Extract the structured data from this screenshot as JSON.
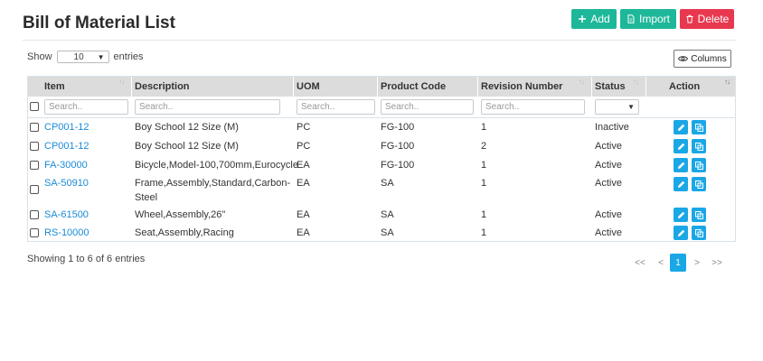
{
  "page": {
    "title": "Bill of Material List"
  },
  "toolbar": {
    "add_label": "Add",
    "import_label": "Import",
    "delete_label": "Delete"
  },
  "length": {
    "show_label": "Show",
    "value": "10",
    "entries_label": "entries"
  },
  "columns_button": {
    "label": "Columns"
  },
  "table": {
    "headers": {
      "item": "Item",
      "description": "Description",
      "uom": "UOM",
      "product_code": "Product Code",
      "revision": "Revision Number",
      "status": "Status",
      "action": "Action"
    },
    "filters": {
      "item": "Search..",
      "description": "Search..",
      "uom": "Search..",
      "product_code": "Search..",
      "revision": "Search.."
    },
    "rows": [
      {
        "item": "CP001-12",
        "description": "Boy School 12 Size (M)",
        "description_2": "",
        "uom": "PC",
        "product_code": "FG-100",
        "revision": "1",
        "status": "Inactive"
      },
      {
        "item": "CP001-12",
        "description": "Boy School 12 Size (M)",
        "description_2": "",
        "uom": "PC",
        "product_code": "FG-100",
        "revision": "2",
        "status": "Active"
      },
      {
        "item": "FA-30000",
        "description": "Bicycle,Model-100,700mm,Eurocycle",
        "description_2": "",
        "uom": "EA",
        "product_code": "FG-100",
        "revision": "1",
        "status": "Active"
      },
      {
        "item": "SA-50910",
        "description": "Frame,Assembly,Standard,Carbon-",
        "description_2": "Steel",
        "uom": "EA",
        "product_code": "SA",
        "revision": "1",
        "status": "Active"
      },
      {
        "item": "SA-61500",
        "description": "Wheel,Assembly,26\"",
        "description_2": "",
        "uom": "EA",
        "product_code": "SA",
        "revision": "1",
        "status": "Active"
      },
      {
        "item": "RS-10000",
        "description": "Seat,Assembly,Racing",
        "description_2": "",
        "uom": "EA",
        "product_code": "SA",
        "revision": "1",
        "status": "Active"
      }
    ]
  },
  "footer": {
    "info": "Showing 1 to 6 of 6 entries"
  },
  "pagination": {
    "first": "<<",
    "prev": "<",
    "current": "1",
    "next": ">",
    "last": ">>"
  },
  "colors": {
    "accent": "#1fb79a",
    "danger": "#e8384f",
    "primary": "#1aa7e6",
    "link": "#1a8bd6"
  }
}
